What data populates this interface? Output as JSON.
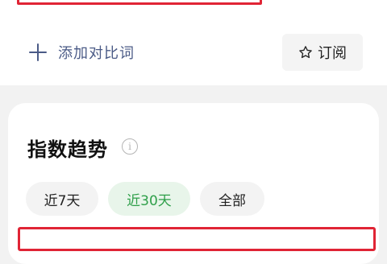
{
  "header": {
    "add_compare_label": "添加对比词",
    "subscribe_label": "订阅"
  },
  "trend": {
    "title": "指数趋势",
    "tabs": [
      {
        "label": "近7天",
        "selected": false
      },
      {
        "label": "近30天",
        "selected": true
      },
      {
        "label": "全部",
        "selected": false
      }
    ]
  },
  "icons": {
    "add": "plus-icon",
    "subscribe": "star-icon",
    "info": "info-icon"
  },
  "colors": {
    "highlight": "#e02435",
    "link": "#4a5a86",
    "tab_selected_text": "#2e9f49",
    "tab_selected_bg": "#e8f5ea"
  }
}
